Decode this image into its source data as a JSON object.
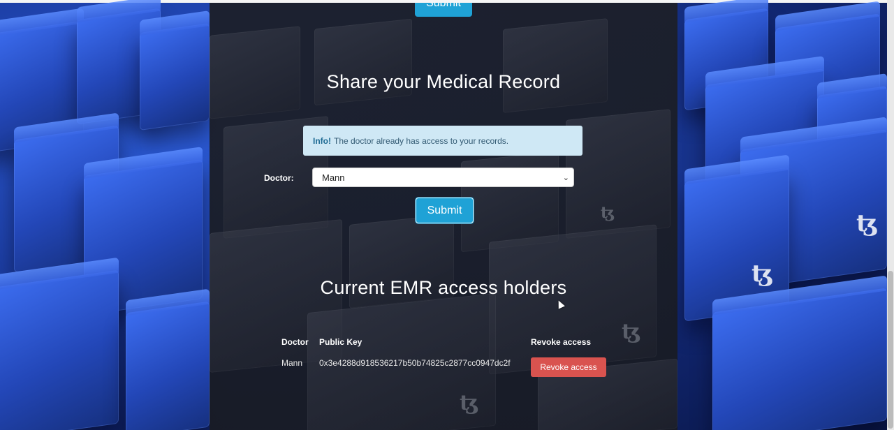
{
  "top_partial_button": {
    "label": "Submit"
  },
  "share_section": {
    "title": "Share your Medical Record",
    "info": {
      "prefix": "Info!",
      "message": "The doctor already has access to your records."
    },
    "doctor_label": "Doctor:",
    "doctor_selected": "Mann",
    "submit_label": "Submit"
  },
  "access_section": {
    "title": "Current EMR access holders",
    "columns": [
      "Doctor",
      "Public Key",
      "Revoke access"
    ],
    "rows": [
      {
        "doctor": "Mann",
        "public_key": "0x3e4288d918536217b50b74825c2877cc0947dc2f",
        "action_label": "Revoke access"
      }
    ]
  },
  "decor": {
    "tezos_glyph": "ꜩ"
  },
  "colors": {
    "primary": "#1fa2d6",
    "danger": "#d9534f",
    "info_bg": "#cfe8f5",
    "panel_bg": "#1c1f28"
  }
}
